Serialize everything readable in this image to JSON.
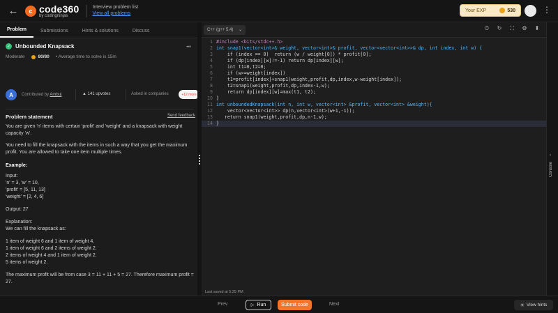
{
  "header": {
    "logo_badge": "c",
    "logo_main": "code360",
    "logo_sub": "by codingninjas",
    "list_title": "Interview problem list",
    "list_link": "View all problems",
    "exp_label": "Your EXP",
    "exp_value": "530"
  },
  "tabs": [
    {
      "label": "Problem",
      "active": true
    },
    {
      "label": "Submissions"
    },
    {
      "label": "Hints & solutions"
    },
    {
      "label": "Discuss"
    }
  ],
  "problem": {
    "title": "Unbounded Knapsack",
    "difficulty": "Moderate",
    "score": "80/80",
    "avg_time": "Average time to solve is 15m",
    "contributor_initial": "A",
    "contributed_by": "Contributed by",
    "contributor": "Ambuj",
    "upvotes": "141 upvotes",
    "asked_in": "Asked in companies",
    "companies_badge": "+12 more",
    "statement_title": "Problem statement",
    "send_feedback": "Send feedback"
  },
  "statement": [
    "You are given 'n' items with certain 'profit' and 'weight' and a knapsack with weight capacity 'w'.",
    "You need to fill the knapsack with the items in such a way that you get the maximum profit. You are allowed to take one item multiple times.",
    "Example:",
    "Input:",
    "'n' = 3, 'w' = 10,",
    "'profit' = [5, 11, 13]",
    "'weight' = [2, 4, 6]",
    "Output: 27",
    "Explanation:",
    "We can fill the knapsack as:",
    "1 item of weight 6 and 1 item of weight 4.",
    "1 item of weight 6 and 2 items of weight 2.",
    "2 items of weight 4 and 1 item of weight 2.",
    "5 items of weight 2.",
    "The maximum profit will be from case 3 = 11 + 11 + 5 = 27. Therefore maximum profit = 27."
  ],
  "editor": {
    "language": "C++ (g++ 5.4)",
    "last_saved": "Last saved at 5:25 PM",
    "lines": [
      "#include <bits/stdc++.h>",
      "int snap1(vector<int>& weight, vector<int>& profit, vector<vector<int>>& dp, int index, int w) {",
      "    if (index == 0)  return (w / weight[0]) * profit[0];",
      "    if (dp[index][w]!=-1) return dp[index][w];",
      "    int t1=0,t2=0;",
      "    if (w>=weight[index])",
      "    t1=profit[index]+snap1(weight,profit,dp,index,w-weight[index]);",
      "    t2=snap1(weight,profit,dp,index-1,w);",
      "    return dp[index][w]=max(t1, t2);",
      "}",
      "int unboundedKnapsack(int n, int w, vector<int> &profit, vector<int> &weight){",
      "    vector<vector<int>> dp(n,vector<int>(w+1,-1));",
      "   return snap1(weight,profit,dp,n-1,w);",
      "}"
    ]
  },
  "sidebar_right": {
    "console": "Console"
  },
  "footer": {
    "prev": "Prev",
    "run": "Run",
    "submit": "Submit code",
    "next": "Next",
    "hints": "View hints"
  }
}
